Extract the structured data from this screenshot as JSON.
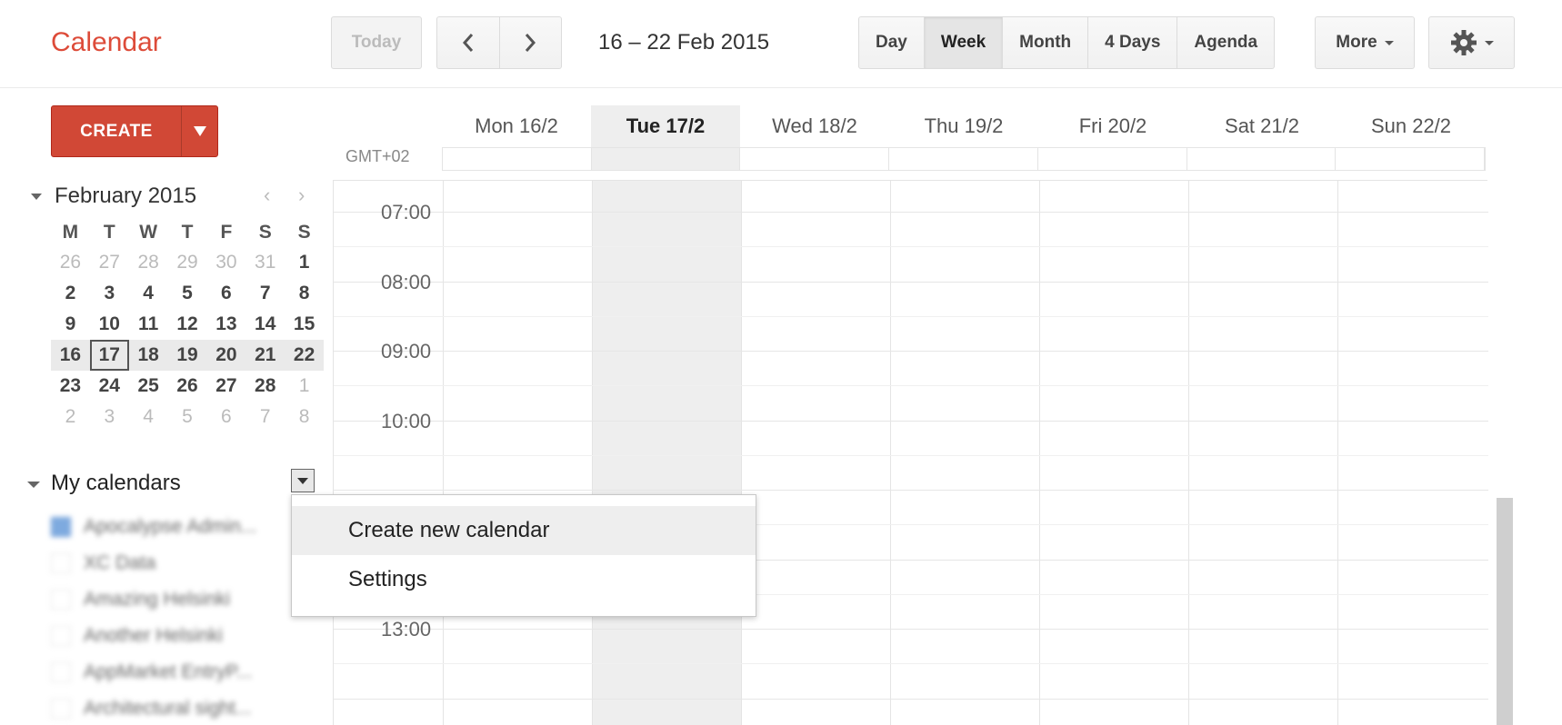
{
  "app": {
    "title": "Calendar"
  },
  "toolbar": {
    "today_label": "Today",
    "prev_icon": "chevron-left-icon",
    "next_icon": "chevron-right-icon",
    "date_range": "16 – 22 Feb 2015",
    "views": [
      {
        "label": "Day",
        "active": false
      },
      {
        "label": "Week",
        "active": true
      },
      {
        "label": "Month",
        "active": false
      },
      {
        "label": "4 Days",
        "active": false
      },
      {
        "label": "Agenda",
        "active": false
      }
    ],
    "more_label": "More",
    "settings_icon": "gear-icon"
  },
  "sidebar": {
    "create_label": "CREATE",
    "mini_calendar": {
      "month_label": "February 2015",
      "weekday_headers": [
        "M",
        "T",
        "W",
        "T",
        "F",
        "S",
        "S"
      ],
      "weeks": [
        [
          "26",
          "27",
          "28",
          "29",
          "30",
          "31",
          "1"
        ],
        [
          "2",
          "3",
          "4",
          "5",
          "6",
          "7",
          "8"
        ],
        [
          "9",
          "10",
          "11",
          "12",
          "13",
          "14",
          "15"
        ],
        [
          "16",
          "17",
          "18",
          "19",
          "20",
          "21",
          "22"
        ],
        [
          "23",
          "24",
          "25",
          "26",
          "27",
          "28",
          "1"
        ],
        [
          "2",
          "3",
          "4",
          "5",
          "6",
          "7",
          "8"
        ]
      ],
      "today": "17"
    },
    "my_calendars_label": "My calendars",
    "calendars": [
      {
        "name": "Apocalypse Admin...",
        "checked": true
      },
      {
        "name": "XC Data",
        "checked": false
      },
      {
        "name": "Amazing Helsinki",
        "checked": false
      },
      {
        "name": "Another Helsinki",
        "checked": false
      },
      {
        "name": "AppMarket EntryP...",
        "checked": false
      },
      {
        "name": "Architectural sight...",
        "checked": false
      }
    ]
  },
  "week": {
    "timezone": "GMT+02",
    "days": [
      {
        "label": "Mon 16/2",
        "today": false
      },
      {
        "label": "Tue 17/2",
        "today": true
      },
      {
        "label": "Wed 18/2",
        "today": false
      },
      {
        "label": "Thu 19/2",
        "today": false
      },
      {
        "label": "Fri 20/2",
        "today": false
      },
      {
        "label": "Sat 21/2",
        "today": false
      },
      {
        "label": "Sun 22/2",
        "today": false
      }
    ],
    "time_labels": [
      "07:00",
      "08:00",
      "09:00",
      "10:00",
      "13:00"
    ]
  },
  "dropdown_menu": {
    "items": [
      {
        "label": "Create new calendar",
        "highlighted": true
      },
      {
        "label": "Settings",
        "highlighted": false
      }
    ]
  },
  "colors": {
    "brand": "#dd4b39",
    "create_button": "#d14836",
    "today_column": "#eeeeee"
  }
}
